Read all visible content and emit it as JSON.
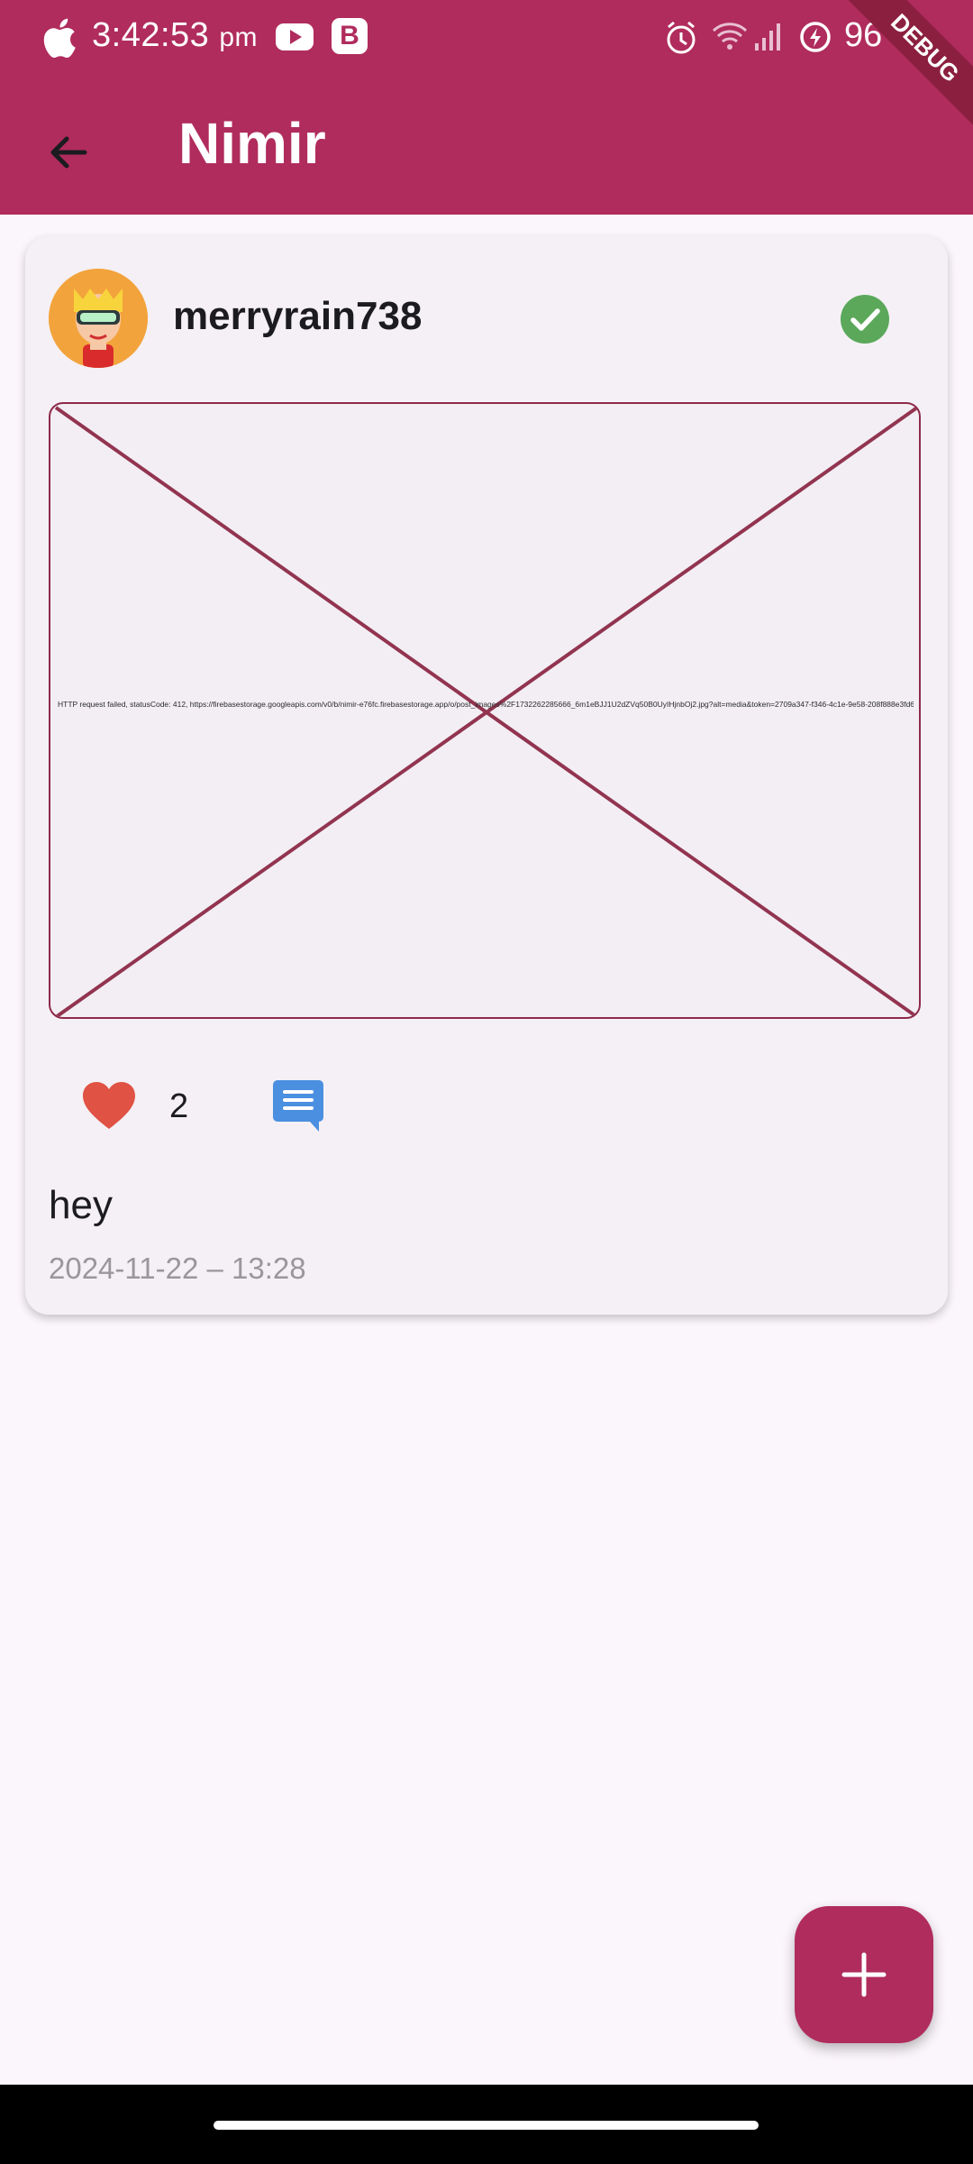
{
  "status_bar": {
    "time": "3:42:53",
    "ampm": "pm",
    "b_badge": "B",
    "battery": "96",
    "debug_banner": "DEBUG"
  },
  "app_bar": {
    "title": "Nimir",
    "back_icon": "arrow-back-icon"
  },
  "post": {
    "username": "merryrain738",
    "verified_icon": "check-circle-icon",
    "image_error": "HTTP request failed, statusCode: 412, https://firebasestorage.googleapis.com/v0/b/nimir-e76fc.firebasestorage.app/o/post_images%2F1732262285666_6m1eBJJ1U2dZVq50B0UyIHjnbOj2.jpg?alt=media&token=2709a347-f346-4c1e-9e58-208f888e3fd6",
    "likes": "2",
    "caption": "hey",
    "timestamp": "2024-11-22 – 13:28",
    "colors": {
      "heart": "#e05244",
      "comment": "#4a8fe0",
      "verified": "#5ba85a"
    }
  },
  "fab": {
    "icon": "plus-icon"
  },
  "theme": {
    "primary": "#b02c5c",
    "background": "#fbf6fb",
    "card": "#f4f0f5"
  }
}
